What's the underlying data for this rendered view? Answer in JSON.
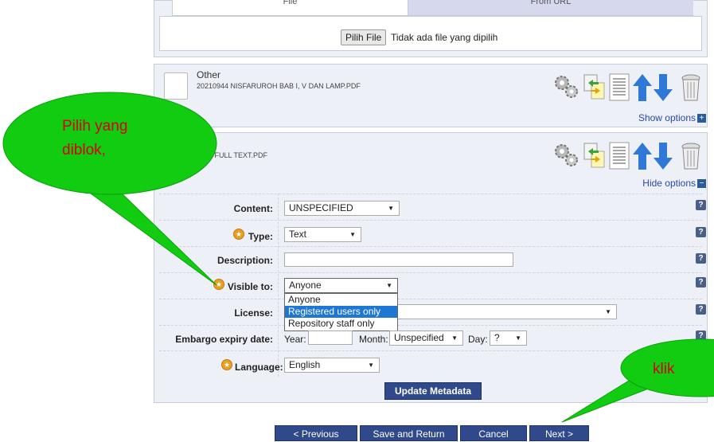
{
  "upload": {
    "tab_file": "File",
    "tab_url": "From URL",
    "choose_button": "Pilih File",
    "no_file_text": "Tidak ada file yang dipilih"
  },
  "doc1": {
    "type": "Other",
    "filename": "20210944 NISFARUROH BAB I, V DAN LAMP.PDF",
    "options_link": "Show options"
  },
  "doc2": {
    "filename": "ROH FULL TEXT.PDF",
    "options_link": "Hide options"
  },
  "form": {
    "content_label": "Content:",
    "content_value": "UNSPECIFIED",
    "type_label": "Type:",
    "type_value": "Text",
    "description_label": "Description:",
    "description_value": "",
    "visible_label": "Visible to:",
    "visible_value": "Anyone",
    "visible_options": [
      "Anyone",
      "Registered users only",
      "Repository staff only"
    ],
    "visible_highlighted": "Registered users only",
    "license_label": "License:",
    "license_value": "",
    "embargo_label": "Embargo expiry date:",
    "year_label": "Year:",
    "year_value": "",
    "month_label": "Month:",
    "month_value": "Unspecified",
    "day_label": "Day:",
    "day_value": "?",
    "language_label": "Language:",
    "language_value": "English",
    "update_button": "Update Metadata",
    "help_glyph": "?"
  },
  "nav": {
    "previous": "< Previous",
    "save_return": "Save and Return",
    "cancel": "Cancel",
    "next": "Next >"
  },
  "annotations": {
    "bubble1_line1": "Pilih yang",
    "bubble1_line2": "diblok,",
    "bubble2": "klik"
  },
  "icons": [
    "gear-icon",
    "transfer-icon",
    "list-icon",
    "arrow-up-icon",
    "arrow-down-icon",
    "trash-icon",
    "star-icon",
    "help-icon",
    "plus-icon",
    "minus-icon"
  ],
  "colors": {
    "panel_bg": "#eef0f8",
    "button_dark": "#30498a",
    "bubble_green": "#11cc11",
    "bubble_text": "#d80000",
    "highlight": "#1e77d3"
  }
}
